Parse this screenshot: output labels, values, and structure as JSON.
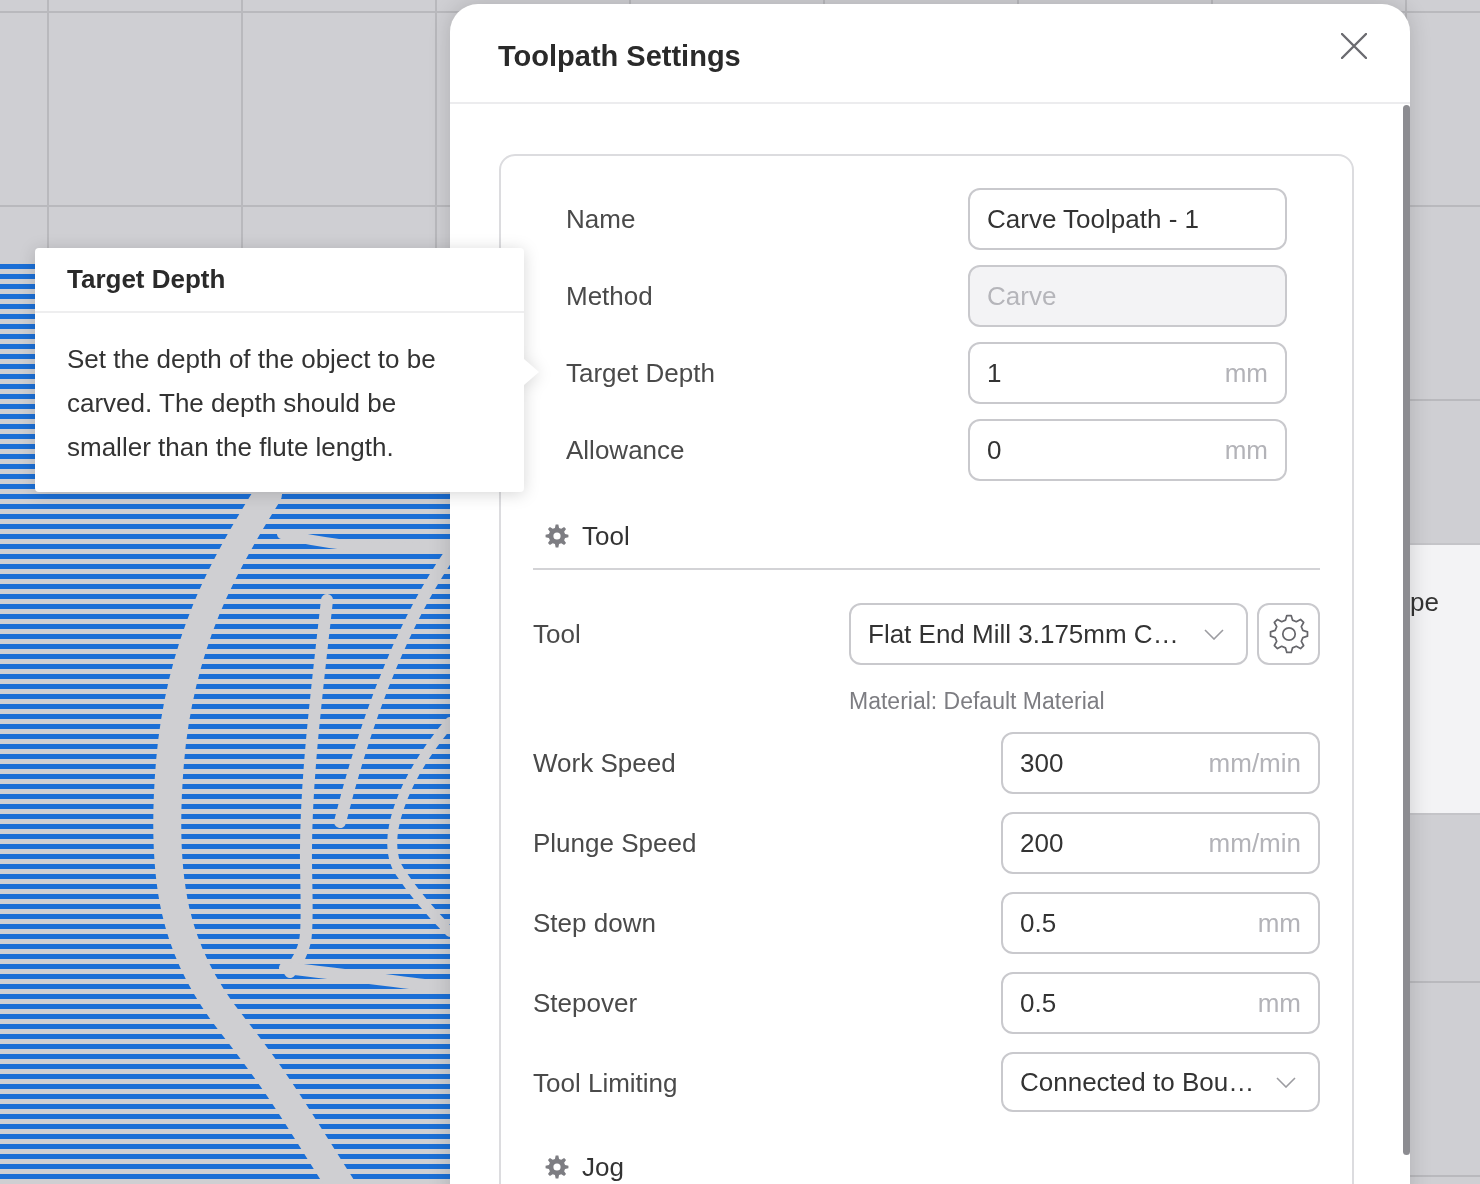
{
  "canvas": {
    "side_panel_label": "pe"
  },
  "tooltip": {
    "title": "Target Depth",
    "text": "Set the depth of the object to be carved. The depth should be smaller than the flute length."
  },
  "dialog": {
    "title": "Toolpath Settings",
    "fields": [
      {
        "kind": "input",
        "label": "Name",
        "value": "Carve Toolpath - 1",
        "disabled": false
      },
      {
        "kind": "input",
        "label": "Method",
        "value": "Carve",
        "disabled": true
      },
      {
        "kind": "input",
        "label": "Target Depth",
        "value": "1",
        "unit": "mm",
        "disabled": false
      },
      {
        "kind": "input",
        "label": "Allowance",
        "value": "0",
        "unit": "mm",
        "disabled": false
      }
    ],
    "sections": [
      {
        "title": "Tool",
        "fields": [
          {
            "kind": "tool_select",
            "label": "Tool",
            "value": "Flat End Mill 3.175mm C…",
            "note": "Material: Default Material",
            "disabled": false
          },
          {
            "kind": "input",
            "label": "Work Speed",
            "value": "300",
            "unit": "mm/min",
            "disabled": false
          },
          {
            "kind": "input",
            "label": "Plunge Speed",
            "value": "200",
            "unit": "mm/min",
            "disabled": false
          },
          {
            "kind": "input",
            "label": "Step down",
            "value": "0.5",
            "unit": "mm",
            "disabled": false
          },
          {
            "kind": "input",
            "label": "Stepover",
            "value": "0.5",
            "unit": "mm",
            "disabled": false
          },
          {
            "kind": "select",
            "label": "Tool Limiting",
            "value": "Connected to Bou…",
            "disabled": false
          }
        ]
      },
      {
        "title": "Jog"
      }
    ]
  }
}
